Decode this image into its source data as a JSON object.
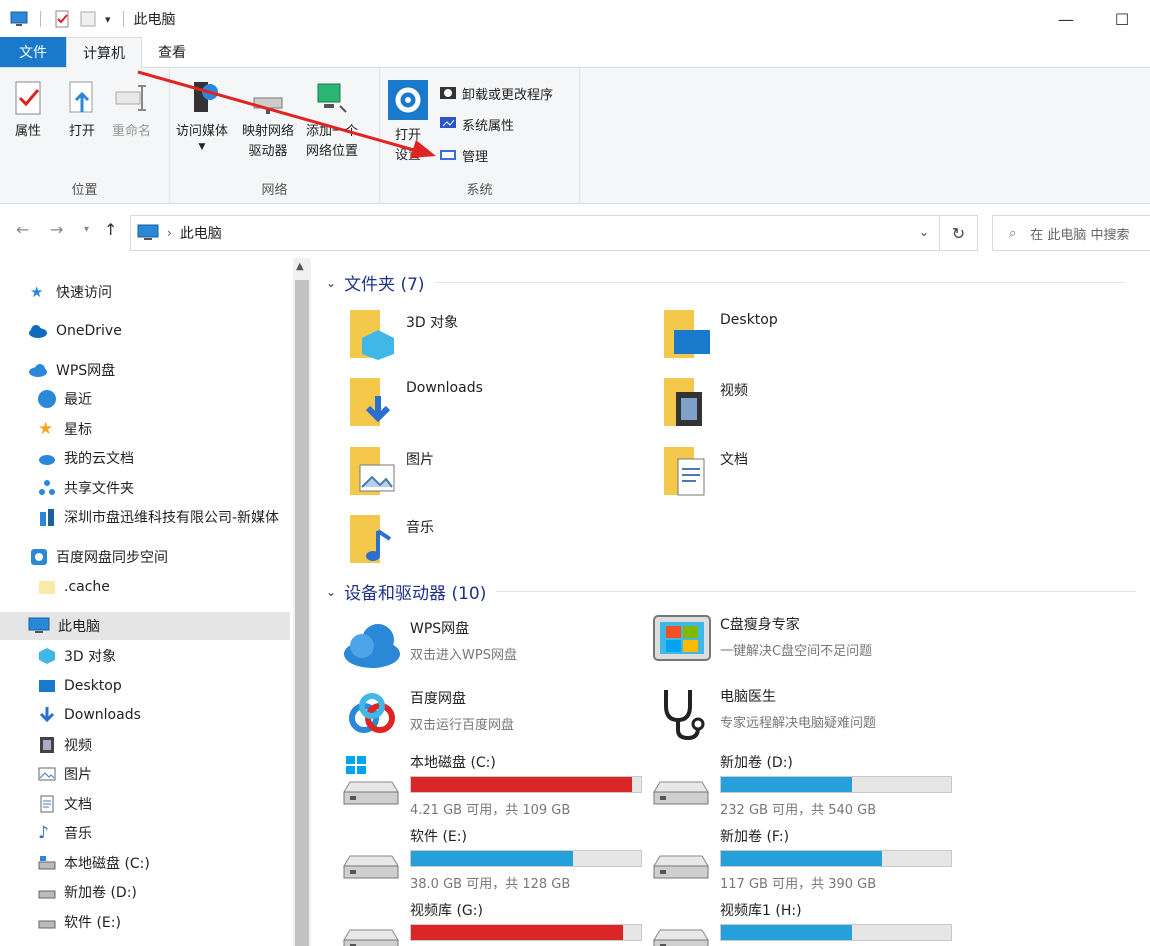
{
  "window": {
    "title": "此电脑",
    "minimize": "—",
    "maximize": "☐"
  },
  "tabs": [
    {
      "label": "文件"
    },
    {
      "label": "计算机"
    },
    {
      "label": "查看"
    }
  ],
  "ribbon": {
    "location_group": {
      "label": "位置",
      "properties": "属性",
      "open": "打开",
      "rename": "重命名"
    },
    "network_group": {
      "label": "网络",
      "access_media": "访问媒体",
      "map_drive_line1": "映射网络",
      "map_drive_line2": "驱动器",
      "add_location_line1": "添加一个",
      "add_location_line2": "网络位置"
    },
    "system_group": {
      "label": "系统",
      "open_settings_line1": "打开",
      "open_settings_line2": "设置",
      "uninstall": "卸载或更改程序",
      "system_properties": "系统属性",
      "manage": "管理"
    }
  },
  "address": {
    "crumb": "此电脑",
    "search_placeholder": "在 此电脑 中搜索"
  },
  "sidebar": {
    "items": [
      {
        "label": "快速访问"
      },
      {
        "label": "OneDrive"
      },
      {
        "label": "WPS网盘"
      },
      {
        "label": "最近"
      },
      {
        "label": "星标"
      },
      {
        "label": "我的云文档"
      },
      {
        "label": "共享文件夹"
      },
      {
        "label": "深圳市盘迅维科技有限公司-新媒体"
      },
      {
        "label": "百度网盘同步空间"
      },
      {
        "label": ".cache"
      },
      {
        "label": "此电脑"
      },
      {
        "label": "3D 对象"
      },
      {
        "label": "Desktop"
      },
      {
        "label": "Downloads"
      },
      {
        "label": "视频"
      },
      {
        "label": "图片"
      },
      {
        "label": "文档"
      },
      {
        "label": "音乐"
      },
      {
        "label": "本地磁盘 (C:)"
      },
      {
        "label": "新加卷 (D:)"
      },
      {
        "label": "软件 (E:)"
      }
    ]
  },
  "content": {
    "folders_header": "文件夹 (7)",
    "folders": [
      {
        "name": "3D 对象"
      },
      {
        "name": "Desktop"
      },
      {
        "name": "Downloads"
      },
      {
        "name": "视频"
      },
      {
        "name": "图片"
      },
      {
        "name": "文档"
      },
      {
        "name": "音乐"
      }
    ],
    "devices_header": "设备和驱动器 (10)",
    "apps": [
      {
        "name": "WPS网盘",
        "sub": "双击进入WPS网盘"
      },
      {
        "name": "C盘瘦身专家",
        "sub": "一键解决C盘空间不足问题"
      },
      {
        "name": "百度网盘",
        "sub": "双击运行百度网盘"
      },
      {
        "name": "电脑医生",
        "sub": "专家远程解决电脑疑难问题"
      }
    ],
    "drives": [
      {
        "name": "本地磁盘 (C:)",
        "free": "4.21 GB 可用，共 109 GB",
        "used_fraction": 0.961,
        "color": "#da2626"
      },
      {
        "name": "新加卷 (D:)",
        "free": "232 GB 可用，共 540 GB",
        "used_fraction": 0.57,
        "color": "#26a0da"
      },
      {
        "name": "软件 (E:)",
        "free": "38.0 GB 可用，共 128 GB",
        "used_fraction": 0.703,
        "color": "#26a0da"
      },
      {
        "name": "新加卷 (F:)",
        "free": "117 GB 可用，共 390 GB",
        "used_fraction": 0.7,
        "color": "#26a0da"
      },
      {
        "name": "视频库 (G:)",
        "free": "",
        "used_fraction": 0.92,
        "color": "#da2626"
      },
      {
        "name": "视频库1 (H:)",
        "free": "",
        "used_fraction": 0.57,
        "color": "#26a0da"
      }
    ]
  },
  "colors": {
    "accent": "#1979ca",
    "drive_ok": "#26a0da",
    "drive_full": "#da2626",
    "arrow": "#e02424",
    "folder": "#f4c84a"
  }
}
